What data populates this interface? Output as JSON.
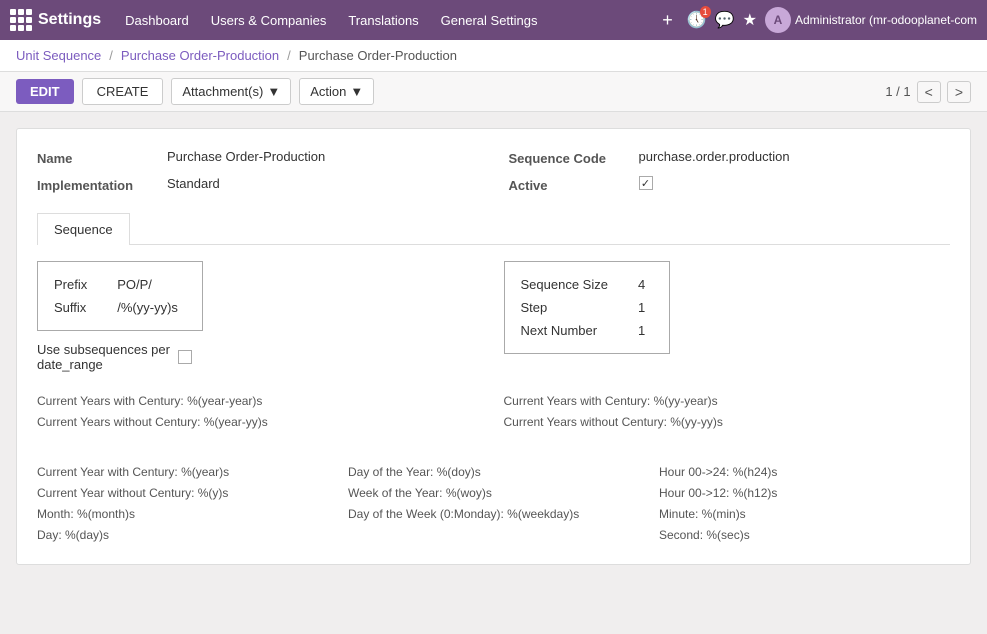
{
  "topbar": {
    "app_name": "Settings",
    "nav_items": [
      {
        "label": "Dashboard",
        "id": "dashboard"
      },
      {
        "label": "Users & Companies",
        "id": "users-companies"
      },
      {
        "label": "Translations",
        "id": "translations"
      },
      {
        "label": "General Settings",
        "id": "general-settings"
      }
    ],
    "user_label": "Administrator (mr-odooplanet-com",
    "notification_count": "1"
  },
  "breadcrumb": {
    "items": [
      {
        "label": "Unit Sequence",
        "id": "unit-sequence"
      },
      {
        "label": "Purchase Order-Production",
        "id": "purchase-order-production-1"
      }
    ],
    "current": "Purchase Order-Production"
  },
  "toolbar": {
    "edit_label": "EDIT",
    "create_label": "CREATE",
    "attachments_label": "Attachment(s)",
    "action_label": "Action",
    "pagination": "1 / 1"
  },
  "record": {
    "name_label": "Name",
    "name_value": "Purchase Order-Production",
    "implementation_label": "Implementation",
    "implementation_value": "Standard",
    "sequence_code_label": "Sequence Code",
    "sequence_code_value": "purchase.order.production",
    "active_label": "Active",
    "active_checked": true
  },
  "tabs": [
    {
      "label": "Sequence",
      "active": true
    }
  ],
  "sequence_tab": {
    "left_box": {
      "rows": [
        {
          "label": "Prefix",
          "value": "PO/P/"
        },
        {
          "label": "Suffix",
          "value": "/%(yy-yy)s"
        }
      ]
    },
    "right_box": {
      "rows": [
        {
          "label": "Sequence Size",
          "value": "4"
        },
        {
          "label": "Step",
          "value": "1"
        },
        {
          "label": "Next Number",
          "value": "1"
        }
      ]
    },
    "subseq_label": "Use subsequences per\ndate_range"
  },
  "info_lines": {
    "group1": [
      {
        "col": 0,
        "text": "Current Years with Century: %(year-year)s"
      },
      {
        "col": 1,
        "text": "Current Years with Century: %(yy-year)s"
      },
      {
        "col": 0,
        "text": "Current Years without Century: %(year-yy)s"
      },
      {
        "col": 1,
        "text": "Current Years without Century: %(yy-yy)s"
      }
    ],
    "group2": [
      {
        "col": 0,
        "text": "Current Year with Century: %(year)s"
      },
      {
        "col": 1,
        "text": "Day of the Year: %(doy)s"
      },
      {
        "col": 2,
        "text": "Hour 00->24: %(h24)s"
      },
      {
        "col": 0,
        "text": "Current Year without Century: %(y)s"
      },
      {
        "col": 1,
        "text": "Week of the Year: %(woy)s"
      },
      {
        "col": 2,
        "text": "Hour 00->12: %(h12)s"
      },
      {
        "col": 0,
        "text": "Month: %(month)s"
      },
      {
        "col": 1,
        "text": "Day of the Week (0:Monday): %(weekday)s"
      },
      {
        "col": 2,
        "text": "Minute: %(min)s"
      },
      {
        "col": 0,
        "text": "Day: %(day)s"
      },
      {
        "col": 1,
        "text": ""
      },
      {
        "col": 2,
        "text": "Second: %(sec)s"
      }
    ]
  }
}
